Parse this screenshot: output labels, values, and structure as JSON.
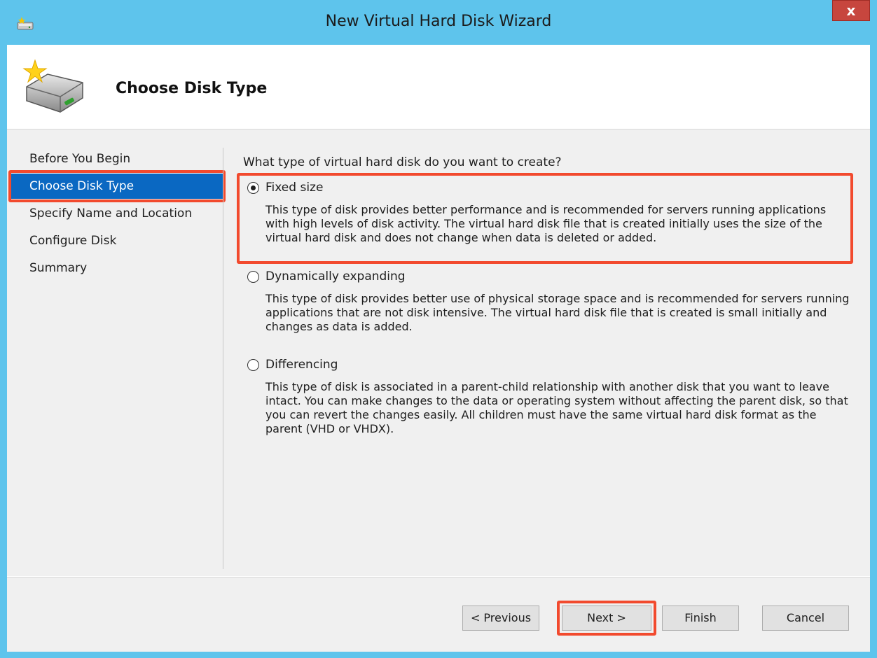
{
  "window": {
    "title": "New Virtual Hard Disk Wizard",
    "close_label": "x",
    "accent_color": "#5ec4ec",
    "close_color": "#c7463e"
  },
  "header": {
    "title": "Choose Disk Type",
    "icon": "hard-disk-wizard-icon"
  },
  "sidebar": {
    "selected_color": "#0a68c2",
    "items": [
      {
        "label": "Before You Begin"
      },
      {
        "label": "Choose Disk Type",
        "selected": true
      },
      {
        "label": "Specify Name and Location"
      },
      {
        "label": "Configure Disk"
      },
      {
        "label": "Summary"
      }
    ]
  },
  "main": {
    "question": "What type of virtual hard disk do you want to create?",
    "options": [
      {
        "label": "Fixed size",
        "selected": true,
        "description": "This type of disk provides better performance and is recommended for servers running applications with high levels of disk activity. The virtual hard disk file that is created initially uses the size of the virtual hard disk and does not change when data is deleted or added."
      },
      {
        "label": "Dynamically expanding",
        "selected": false,
        "description": "This type of disk provides better use of physical storage space and is recommended for servers running applications that are not disk intensive. The virtual hard disk file that is created is small initially and changes as data is added."
      },
      {
        "label": "Differencing",
        "selected": false,
        "description": "This type of disk is associated in a parent-child relationship with another disk that you want to leave intact. You can make changes to the data or operating system without affecting the parent disk, so that you can revert the changes easily. All children must have the same virtual hard disk format as the parent (VHD or VHDX)."
      }
    ]
  },
  "footer": {
    "previous_label": "< Previous",
    "next_label": "Next >",
    "finish_label": "Finish",
    "cancel_label": "Cancel"
  },
  "annotation_color": "#f24a2e"
}
